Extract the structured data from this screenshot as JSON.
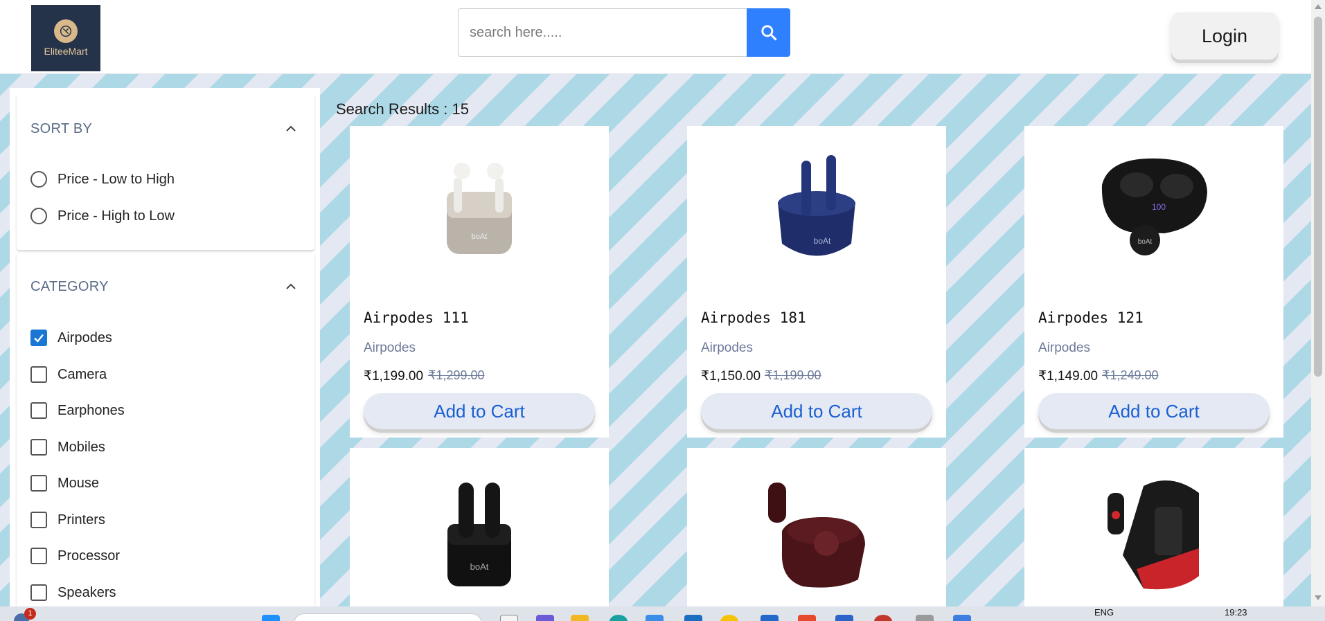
{
  "header": {
    "logo_text": "EliteeMart",
    "search_placeholder": "search here.....",
    "login_label": "Login"
  },
  "sidebar": {
    "sort": {
      "title": "SORT BY",
      "options": [
        {
          "label": "Price - Low to High",
          "selected": false
        },
        {
          "label": "Price - High to Low",
          "selected": false
        }
      ]
    },
    "category": {
      "title": "CATEGORY",
      "options": [
        {
          "label": "Airpodes",
          "checked": true
        },
        {
          "label": "Camera",
          "checked": false
        },
        {
          "label": "Earphones",
          "checked": false
        },
        {
          "label": "Mobiles",
          "checked": false
        },
        {
          "label": "Mouse",
          "checked": false
        },
        {
          "label": "Printers",
          "checked": false
        },
        {
          "label": "Processor",
          "checked": false
        },
        {
          "label": "Speakers",
          "checked": false
        }
      ]
    }
  },
  "results": {
    "title": "Search Results : 15",
    "products": [
      {
        "name": "Airpodes 111",
        "category": "Airpodes",
        "price": "₹1,199.00",
        "old_price": "₹1,299.00",
        "cart_label": "Add to Cart",
        "image": "white-earbuds-image"
      },
      {
        "name": "Airpodes 181",
        "category": "Airpodes",
        "price": "₹1,150.00",
        "old_price": "₹1,199.00",
        "cart_label": "Add to Cart",
        "image": "blue-earbuds-image"
      },
      {
        "name": "Airpodes 121",
        "category": "Airpodes",
        "price": "₹1,149.00",
        "old_price": "₹1,249.00",
        "cart_label": "Add to Cart",
        "image": "black-earbuds-case-image"
      },
      {
        "name": "",
        "category": "",
        "price": "",
        "old_price": "",
        "cart_label": "",
        "image": "black-earbuds-image"
      },
      {
        "name": "",
        "category": "",
        "price": "",
        "old_price": "",
        "cart_label": "",
        "image": "maroon-earbuds-image"
      },
      {
        "name": "",
        "category": "",
        "price": "",
        "old_price": "",
        "cart_label": "",
        "image": "gaming-earbuds-image"
      }
    ]
  },
  "taskbar": {
    "notification_count": "1",
    "lang": "ENG",
    "time": "19:23"
  },
  "colors": {
    "accent_blue": "#2f80ff",
    "checkbox_blue": "#1976d2",
    "stripe_light_blue": "#add8e6",
    "stripe_pale": "#e3e8f3",
    "cart_text": "#1a5fd1",
    "logo_bg": "#24334a"
  }
}
